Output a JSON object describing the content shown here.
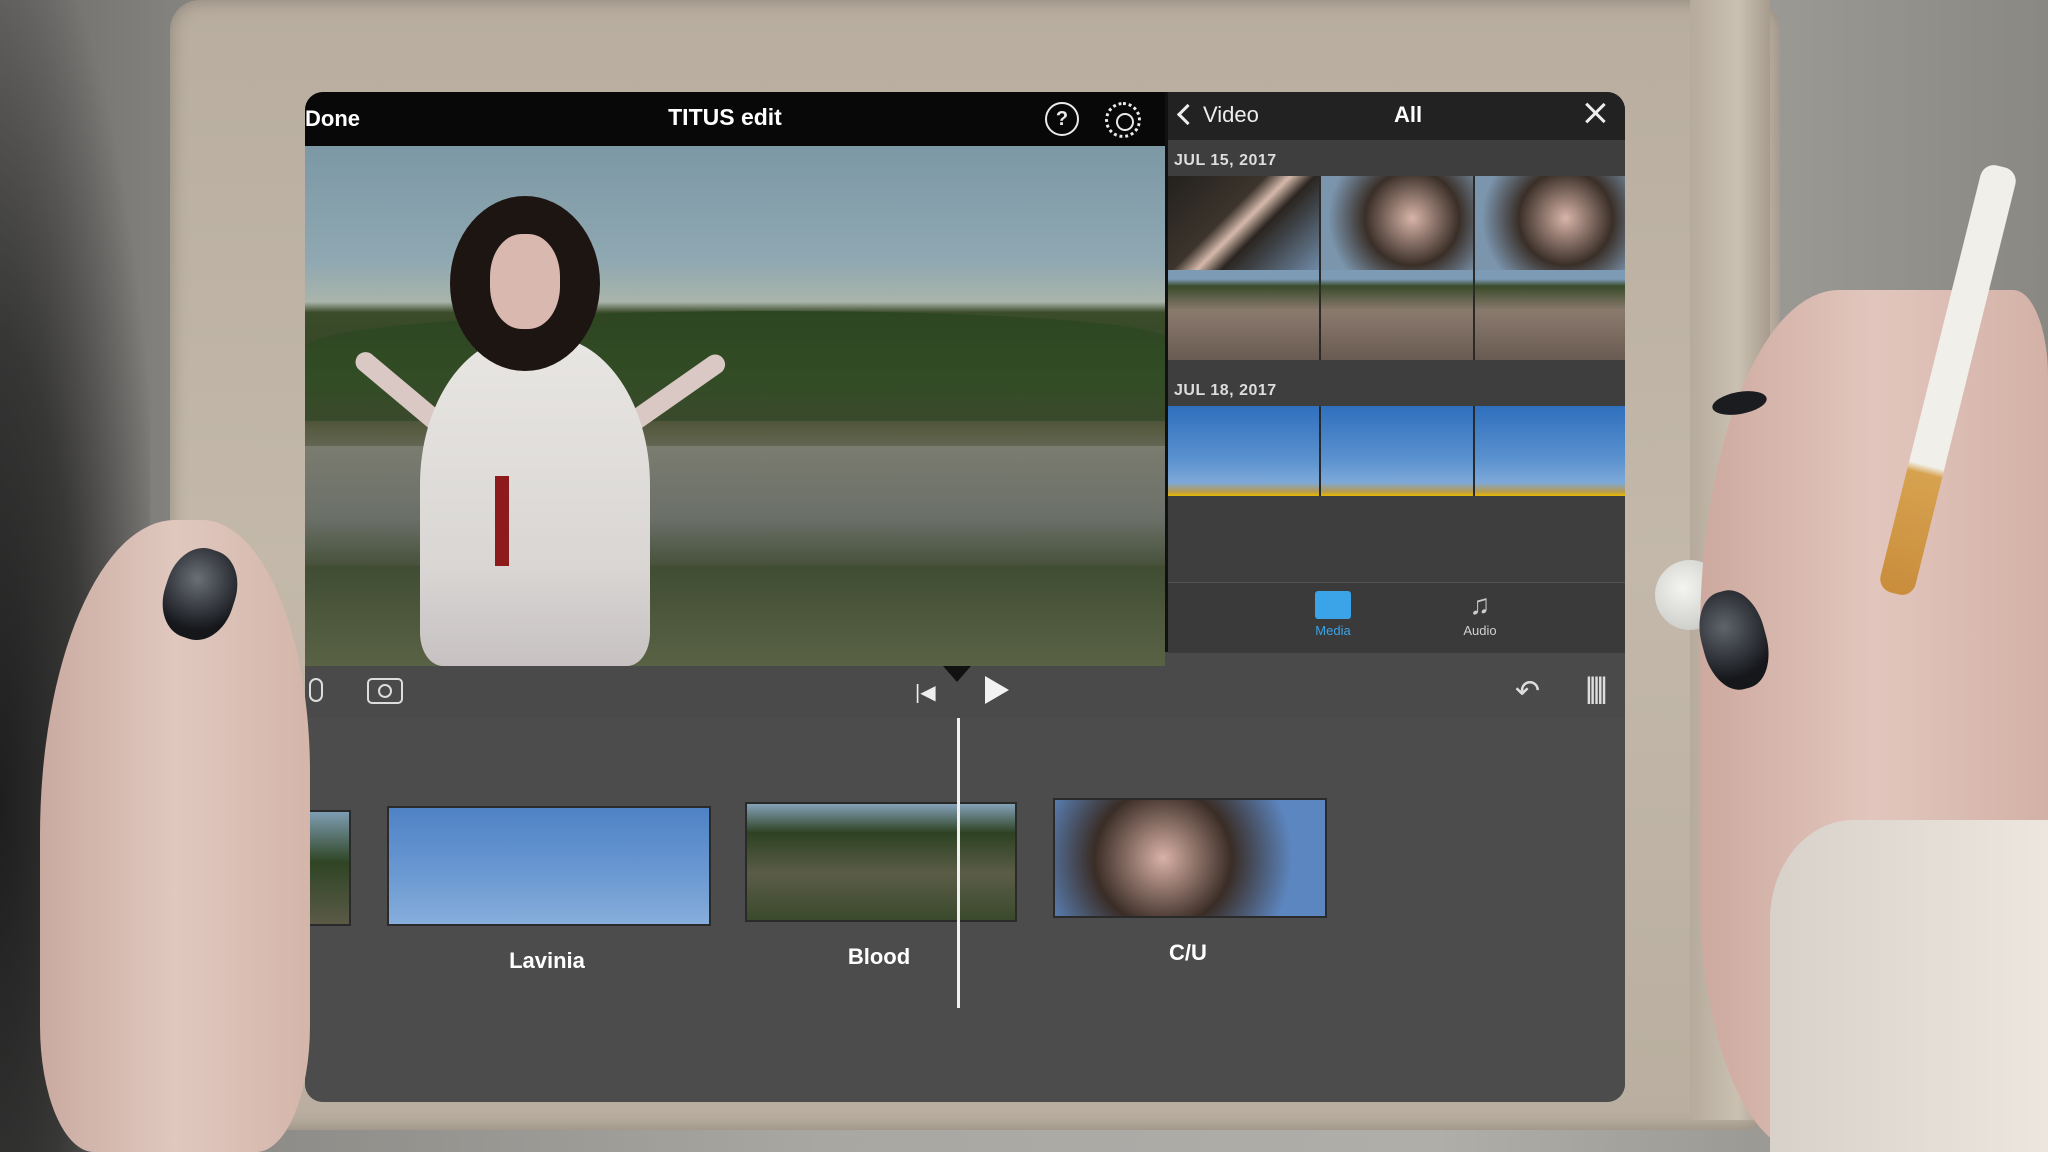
{
  "editor": {
    "done_label": "Done",
    "project_title": "TITUS edit",
    "help_icon": "?"
  },
  "browser": {
    "back_label": "Video",
    "filter_label": "All",
    "groups": [
      {
        "date": "JUL 15, 2017"
      },
      {
        "date": "JUL 18, 2017"
      }
    ],
    "tabs": [
      {
        "label": "Media",
        "icon": "media-icon",
        "color": "#3ba3e8"
      },
      {
        "label": "Audio",
        "icon": "music-note-icon"
      }
    ]
  },
  "controls": {
    "undo_icon": "↶",
    "waveform_icon": "|||||",
    "skip_back_icon": "|◀"
  },
  "timeline": {
    "clips": [
      {
        "label": ""
      },
      {
        "label": "Lavinia"
      },
      {
        "label": "Blood"
      },
      {
        "label": "C/U"
      }
    ]
  }
}
